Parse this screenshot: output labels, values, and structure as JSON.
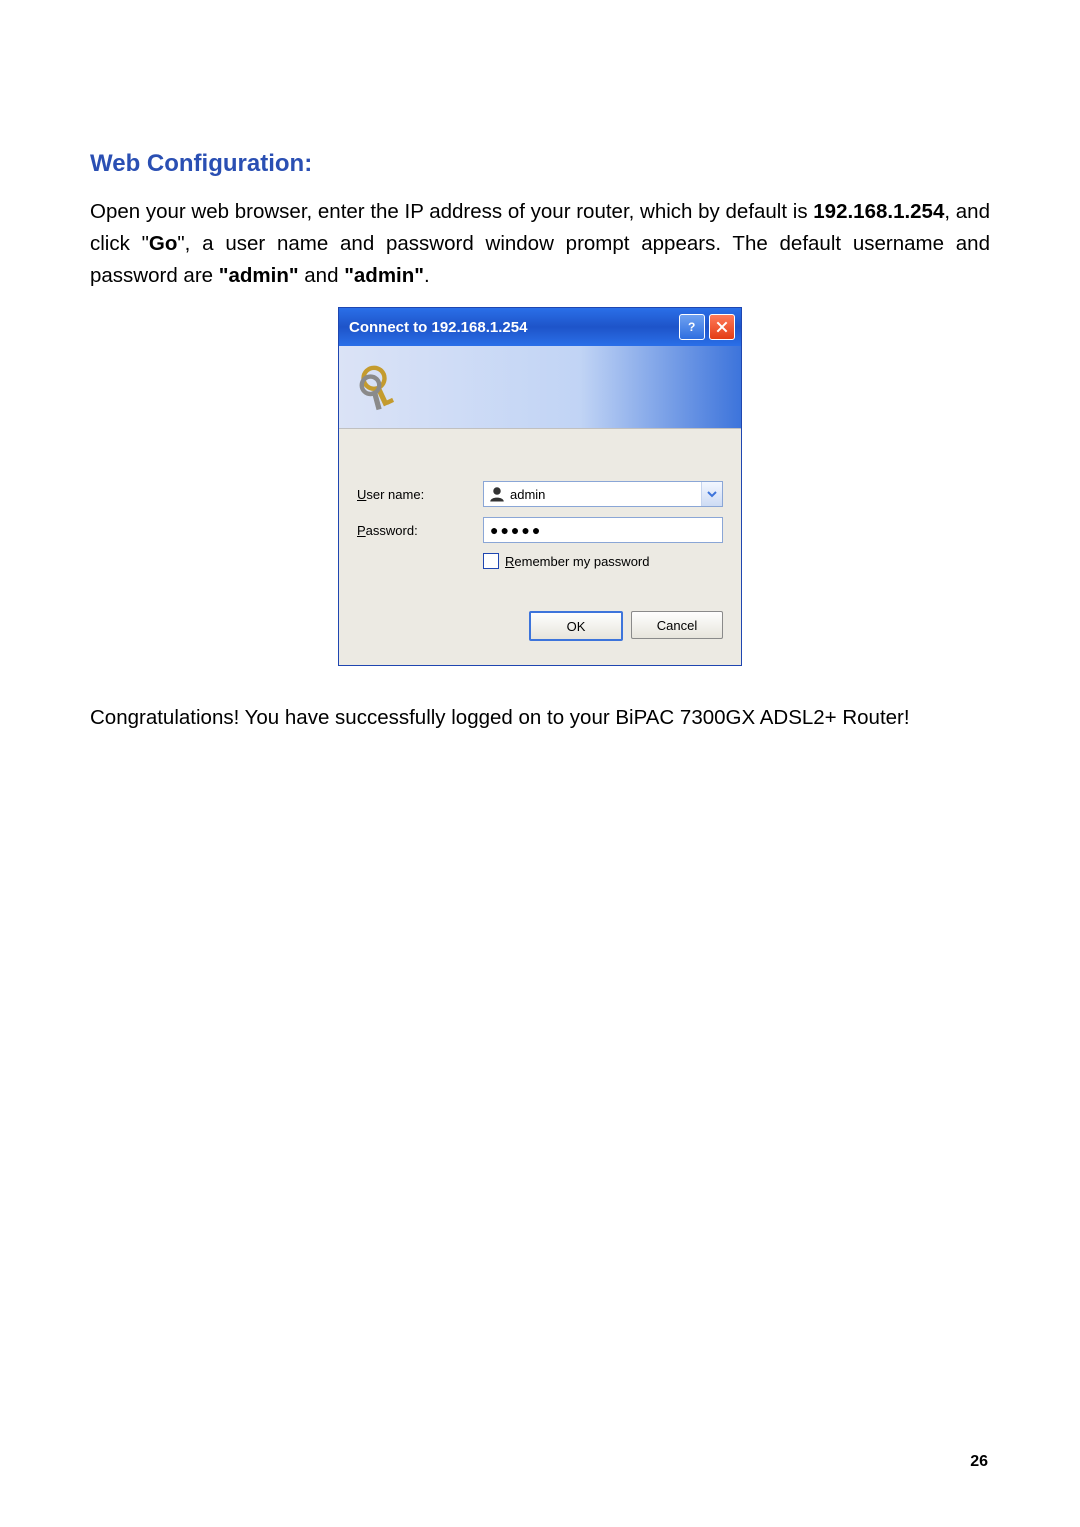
{
  "heading": "Web Configuration:",
  "para1": {
    "pre": "Open your web browser, enter the IP address of your router, which by default is ",
    "ip": "192.168.1.254",
    "mid1": ", and click \"",
    "go": "Go",
    "mid2": "\", a user name and password window prompt appears. The default username and password are ",
    "adm1": "\"admin\"",
    "and": " and ",
    "adm2": "\"admin\"",
    "end": "."
  },
  "dialog": {
    "title": "Connect to 192.168.1.254",
    "username_label_u": "U",
    "username_label_rest": "ser name:",
    "password_label_p": "P",
    "password_label_rest": "assword:",
    "username_value": "admin",
    "password_value": "●●●●●",
    "remember_r": "R",
    "remember_rest": "emember my password",
    "ok": "OK",
    "cancel": "Cancel"
  },
  "congrats": "Congratulations! You have successfully logged on to your BiPAC 7300GX ADSL2+ Router!",
  "page_number": "26"
}
